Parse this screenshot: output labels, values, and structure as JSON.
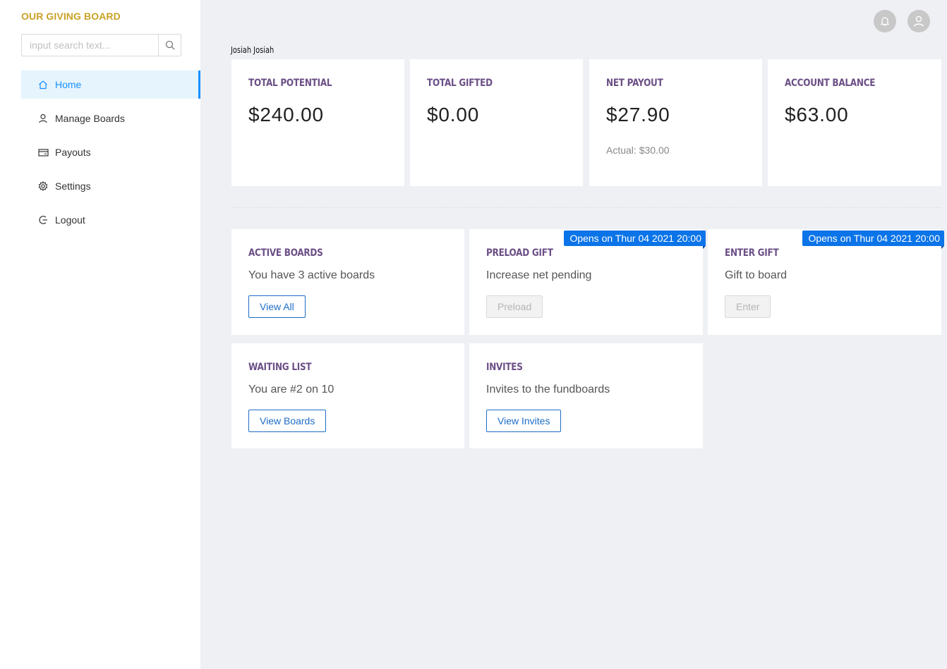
{
  "brand": "OUR GIVING BOARD",
  "search": {
    "placeholder": "input search text..."
  },
  "nav": [
    {
      "label": "Home",
      "icon": "home-icon",
      "active": true
    },
    {
      "label": "Manage Boards",
      "icon": "user-icon"
    },
    {
      "label": "Payouts",
      "icon": "credit-card-icon"
    },
    {
      "label": "Settings",
      "icon": "gear-icon"
    },
    {
      "label": "Logout",
      "icon": "logout-icon"
    }
  ],
  "header": {
    "user_name": "Josiah Josiah",
    "icons": [
      "bell-icon",
      "avatar-icon"
    ]
  },
  "stats": [
    {
      "label": "TOTAL POTENTIAL",
      "value": "$240.00"
    },
    {
      "label": "TOTAL GIFTED",
      "value": "$0.00"
    },
    {
      "label": "NET PAYOUT",
      "value": "$27.90",
      "sub": "Actual: $30.00"
    },
    {
      "label": "ACCOUNT BALANCE",
      "value": "$63.00"
    }
  ],
  "tiles": {
    "active_boards": {
      "title": "ACTIVE BOARDS",
      "desc": "You have 3 active boards",
      "button": "View All"
    },
    "preload_gift": {
      "title": "PRELOAD GIFT",
      "desc": "Increase net pending",
      "button": "Preload",
      "ribbon": "Opens on Thur 04 2021 20:00"
    },
    "enter_gift": {
      "title": "ENTER GIFT",
      "desc": "Gift to board",
      "button": "Enter",
      "ribbon": "Opens on Thur 04 2021 20:00"
    },
    "waiting_list": {
      "title": "WAITING LIST",
      "desc": "You are #2 on 10",
      "button": "View Boards"
    },
    "invites": {
      "title": "INVITES",
      "desc": "Invites to the fundboards",
      "button": "View Invites"
    }
  },
  "colors": {
    "brand": "#c9a227",
    "accent": "#1890ff",
    "title_purple": "#6b4f86",
    "ribbon": "#0b74e8"
  }
}
